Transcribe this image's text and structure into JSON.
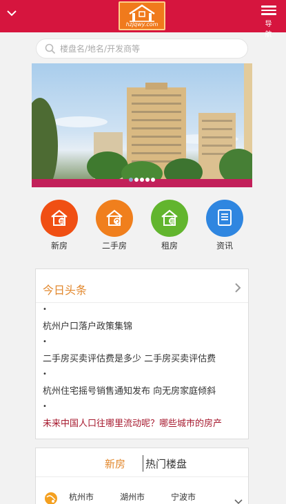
{
  "header": {
    "logo_text": "hzjqwy.com",
    "nav_label": "导 航"
  },
  "search": {
    "placeholder": "楼盘名/地名/开发商等"
  },
  "banner": {
    "slide_count": 5,
    "active_slide": 1
  },
  "quick_nav": [
    {
      "label": "新房",
      "icon": "house-new-icon",
      "color": "#f04f13"
    },
    {
      "label": "二手房",
      "icon": "house-resale-icon",
      "color": "#f07f1d"
    },
    {
      "label": "租房",
      "icon": "house-rent-icon",
      "color": "#62b52e"
    },
    {
      "label": "资讯",
      "icon": "news-document-icon",
      "color": "#2f86e0"
    }
  ],
  "headlines": {
    "title": "今日头条",
    "bullet": "•",
    "items": [
      {
        "text": "杭州户口落户政策集锦"
      },
      {
        "text": "二手房买卖评估费是多少 二手房买卖评估费"
      },
      {
        "text": "杭州住宅摇号销售通知发布 向无房家庭倾斜"
      },
      {
        "text": "未来中国人口往哪里流动呢？哪些城市的房产"
      }
    ]
  },
  "listings": {
    "tabs": [
      "新房",
      "热门楼盘"
    ],
    "cities": [
      "杭州市",
      "湖州市",
      "宁波市"
    ]
  },
  "colors": {
    "header": "#d6153e",
    "accent": "#e2872c",
    "hot_text": "#a6192e"
  }
}
